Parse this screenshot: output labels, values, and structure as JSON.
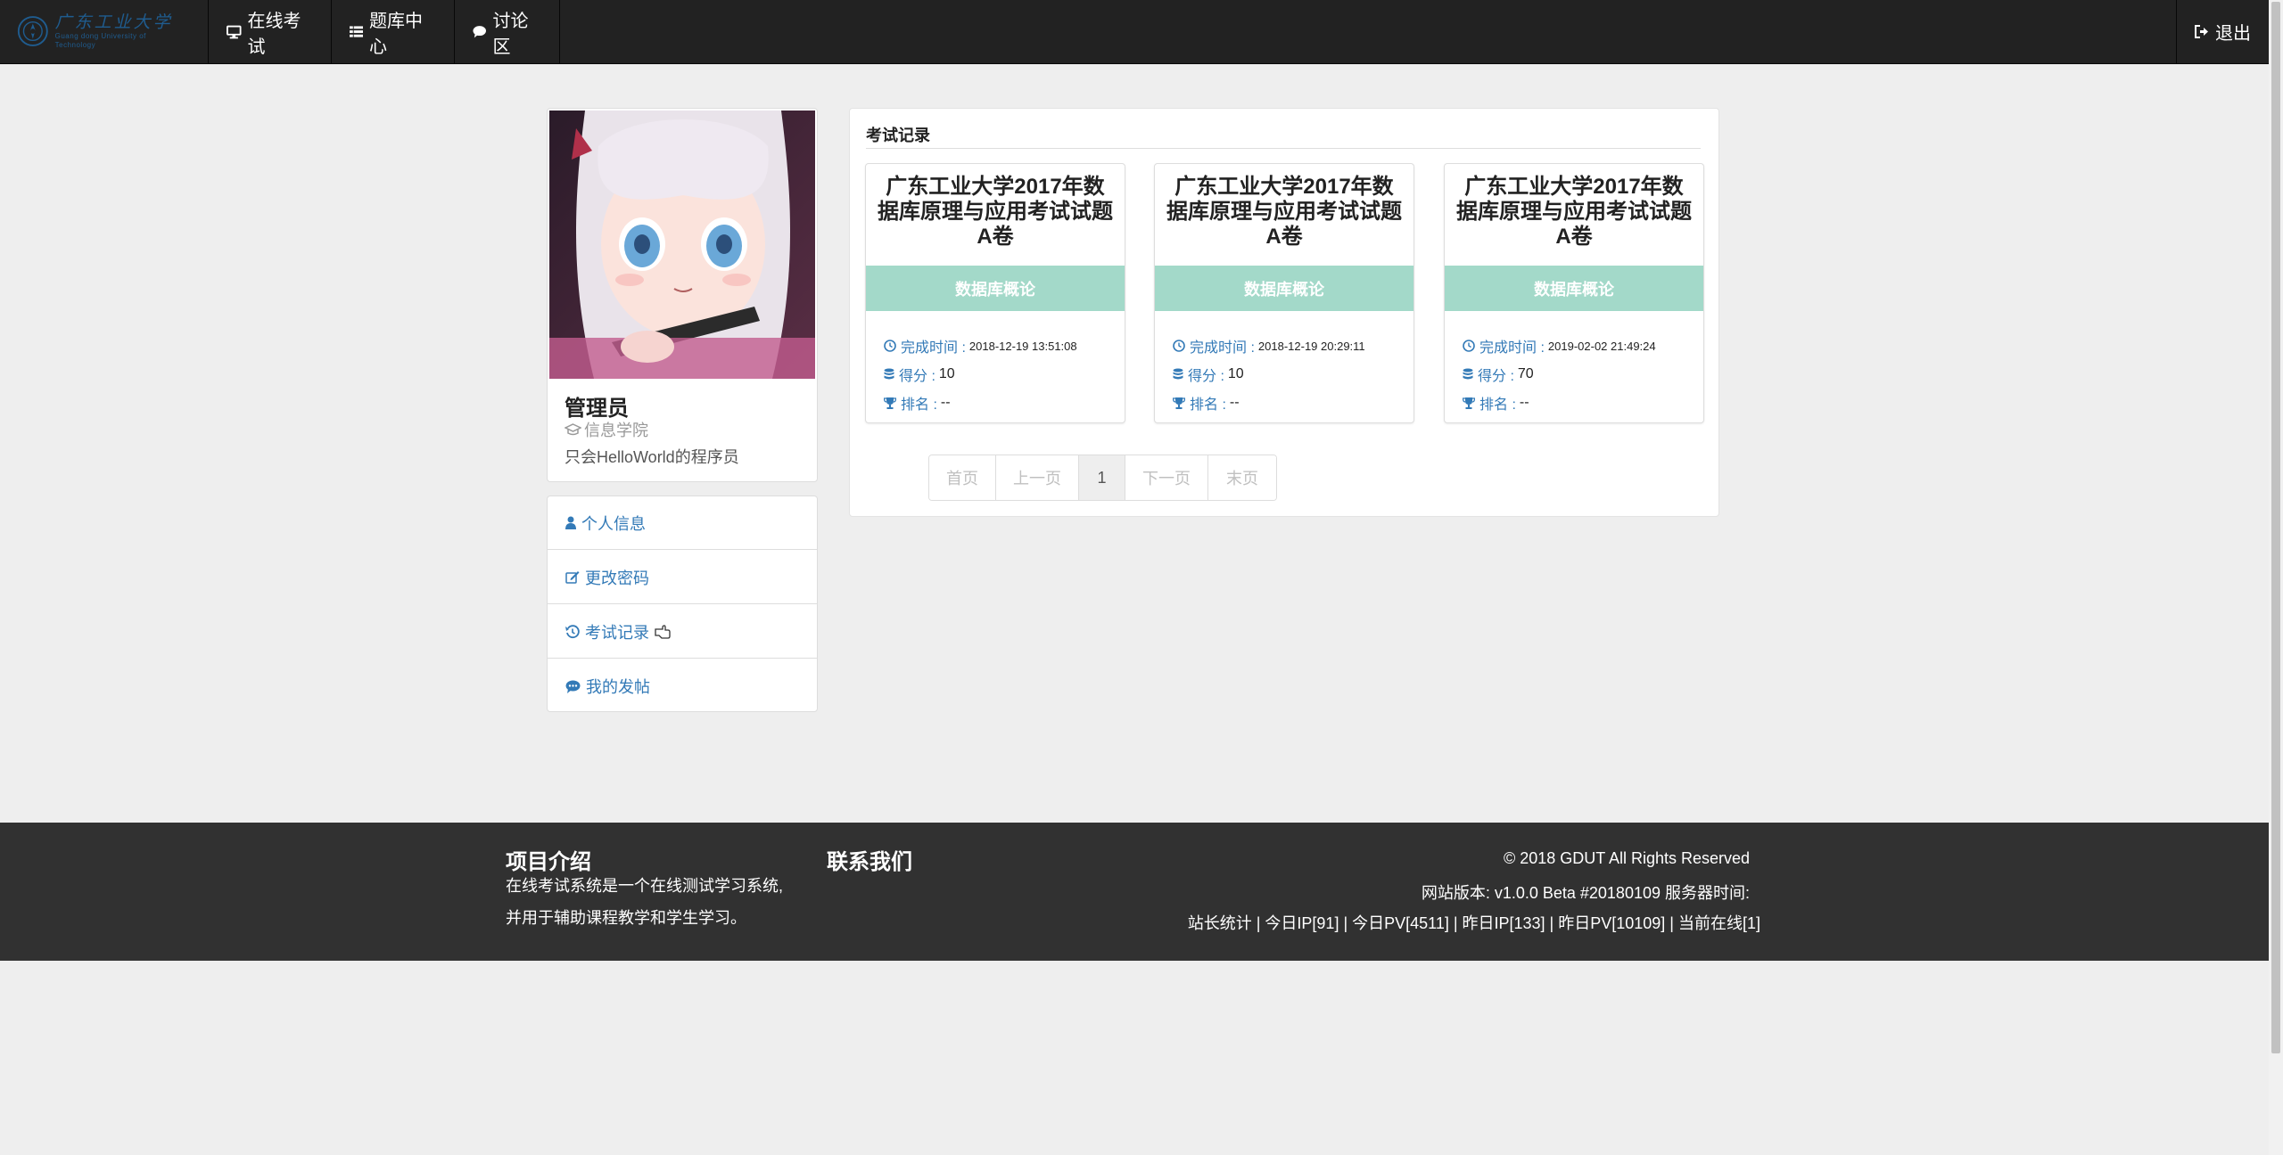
{
  "nav": {
    "brand_cn": "广东工业大学",
    "brand_en": "Guang dong University of Technology",
    "items": [
      {
        "label": "在线考试",
        "icon": "desktop-icon"
      },
      {
        "label": "题库中心",
        "icon": "list-icon"
      },
      {
        "label": "讨论区",
        "icon": "comment-icon"
      }
    ],
    "logout": "退出"
  },
  "profile": {
    "name": "管理员",
    "college": "信息学院",
    "motto": "只会HelloWorld的程序员"
  },
  "menu": [
    {
      "label": "个人信息",
      "icon": "user-icon"
    },
    {
      "label": "更改密码",
      "icon": "edit-icon"
    },
    {
      "label": "考试记录",
      "icon": "history-icon"
    },
    {
      "label": "我的发帖",
      "icon": "comments-icon"
    }
  ],
  "records": {
    "title": "考试记录",
    "time_label": "完成时间 :",
    "score_label": "得分 :",
    "rank_label": "排名 :",
    "items": [
      {
        "title": "广东工业大学2017年数据库原理与应用考试试题A卷",
        "tag": "数据库概论",
        "time": "2018-12-19 13:51:08",
        "score": "10",
        "rank": "--"
      },
      {
        "title": "广东工业大学2017年数据库原理与应用考试试题A卷",
        "tag": "数据库概论",
        "time": "2018-12-19 20:29:11",
        "score": "10",
        "rank": "--"
      },
      {
        "title": "广东工业大学2017年数据库原理与应用考试试题A卷",
        "tag": "数据库概论",
        "time": "2019-02-02 21:49:24",
        "score": "70",
        "rank": "--"
      }
    ]
  },
  "pagination": {
    "first": "首页",
    "prev": "上一页",
    "current": "1",
    "next": "下一页",
    "last": "末页"
  },
  "footer": {
    "about_title": "项目介绍",
    "about_line1": "在线考试系统是一个在线测试学习系统,",
    "about_line2": "并用于辅助课程教学和学生学习。",
    "contact_title": "联系我们",
    "copyright": "© 2018 GDUT All Rights Reserved",
    "version": "网站版本:  v1.0.0 Beta #20180109   服务器时间:",
    "stats": "站长统计 | 今日IP[91] | 今日PV[4511] | 昨日IP[133] | 昨日PV[10109] | 当前在线[1]"
  },
  "colors": {
    "navbar": "#222222",
    "link": "#337ab7",
    "tag": "#a3d9c9",
    "footer": "#313131",
    "page_bg": "#eeeeee"
  }
}
